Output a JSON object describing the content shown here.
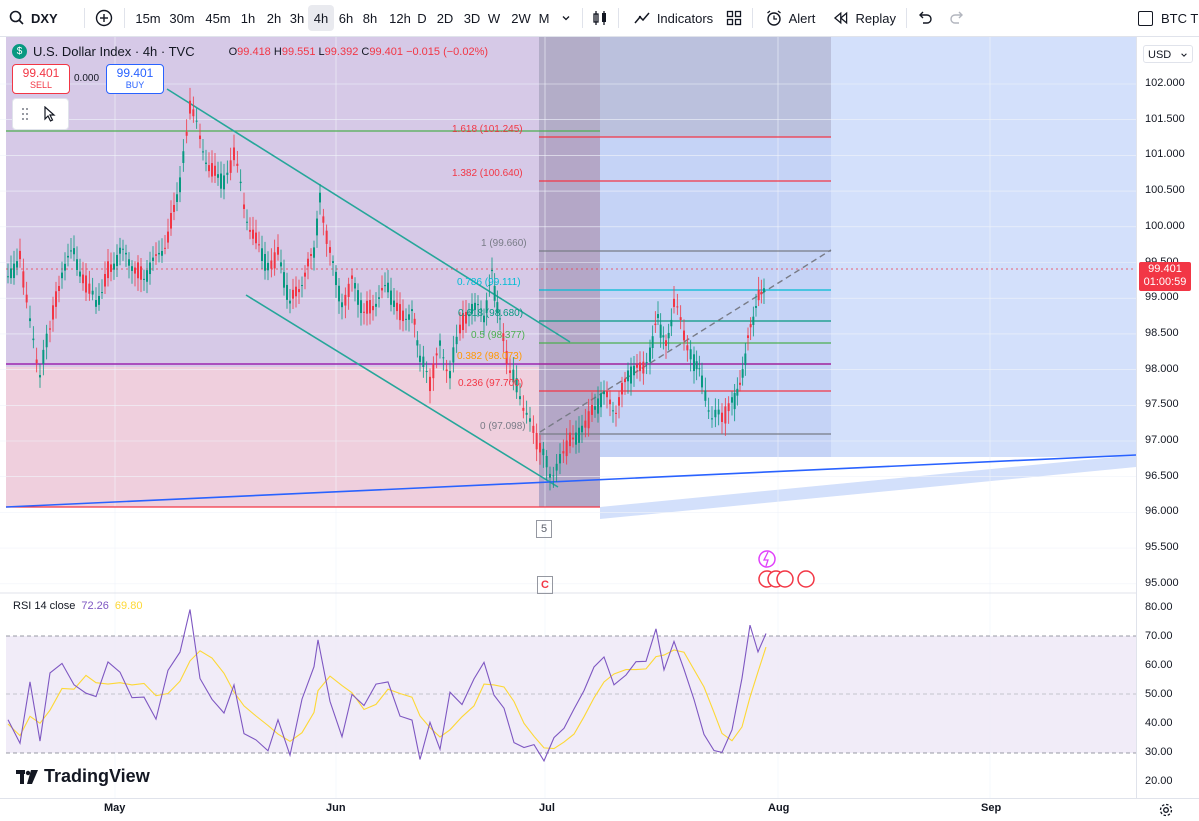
{
  "toolbar": {
    "symbol": "DXY",
    "timeframes": [
      "15m",
      "30m",
      "45m",
      "1h",
      "2h",
      "3h",
      "4h",
      "6h",
      "8h",
      "12h",
      "D",
      "2D",
      "3D",
      "W",
      "2W",
      "M"
    ],
    "active_timeframe": "4h",
    "indicators_label": "Indicators",
    "alert_label": "Alert",
    "replay_label": "Replay",
    "compare_label": "BTC T"
  },
  "legend": {
    "title": "U.S. Dollar Index · 4h · TVC",
    "o_label": "O",
    "o_value": "99.418",
    "h_label": "H",
    "h_value": "99.551",
    "l_label": "L",
    "l_value": "99.392",
    "c_label": "C",
    "c_value": "99.401",
    "change": "−0.015 (−0.02%)"
  },
  "trade": {
    "sell_price": "99.401",
    "sell_label": "SELL",
    "spread": "0.000",
    "buy_price": "99.401",
    "buy_label": "BUY"
  },
  "price_scale": {
    "currency": "USD",
    "labels": [
      "102.000",
      "101.500",
      "101.000",
      "100.500",
      "100.000",
      "99.500",
      "99.000",
      "98.500",
      "98.000",
      "97.500",
      "97.000",
      "96.500",
      "96.000",
      "95.500",
      "95.000"
    ],
    "current_price": "99.401",
    "countdown": "01:00:59"
  },
  "fib_levels": [
    {
      "label": "1.618 (101.245)",
      "color": "#f23645"
    },
    {
      "label": "1.382 (100.640)",
      "color": "#f23645"
    },
    {
      "label": "1 (99.660)",
      "color": "#787b86"
    },
    {
      "label": "0.786 (99.111)",
      "color": "#00bcd4"
    },
    {
      "label": "0.618 (98.680)",
      "color": "#089981"
    },
    {
      "label": "0.5 (98.377)",
      "color": "#4caf50"
    },
    {
      "label": "0.382 (98.073)",
      "color": "#ff9800"
    },
    {
      "label": "0.236 (97.700)",
      "color": "#f23645"
    },
    {
      "label": "0 (97.098)",
      "color": "#787b86"
    }
  ],
  "markers": {
    "wave": "5",
    "corr": "C"
  },
  "rsi": {
    "label": "RSI 14 close",
    "value": "72.26",
    "ma_value": "69.80",
    "labels": [
      "80.00",
      "70.00",
      "60.00",
      "50.00",
      "40.00",
      "30.00",
      "20.00"
    ],
    "line_color": "#7e57c2",
    "ma_color": "#fdd835"
  },
  "time_axis": [
    "May",
    "Jun",
    "Jul",
    "Aug",
    "Sep"
  ],
  "logo": "TradingView",
  "colors": {
    "up": "#089981",
    "down": "#f23645",
    "channel": "#26a69a",
    "trendline": "#2962ff"
  }
}
